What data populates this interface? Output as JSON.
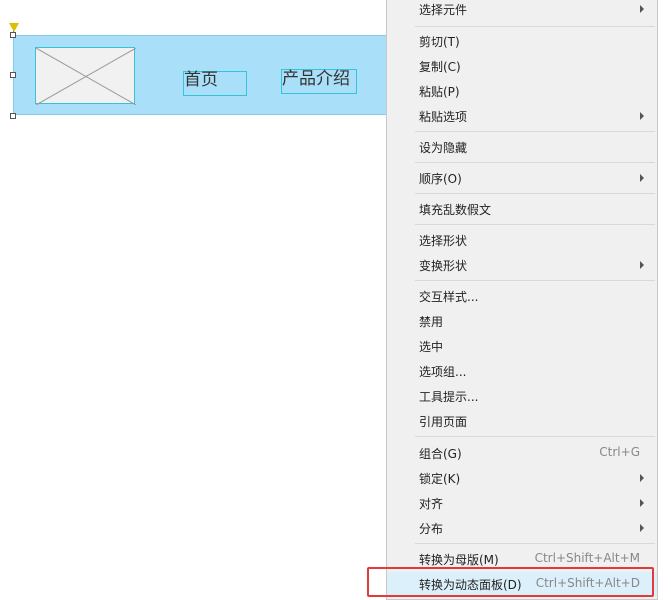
{
  "canvas": {
    "nav_home": "首页",
    "nav_products": "产品介绍"
  },
  "context_menu": {
    "items": [
      {
        "label": "选择元件",
        "submenu": true
      },
      {
        "label": "剪切(T)"
      },
      {
        "label": "复制(C)"
      },
      {
        "label": "粘贴(P)"
      },
      {
        "label": "粘贴选项",
        "submenu": true
      },
      {
        "label": "设为隐藏"
      },
      {
        "label": "顺序(O)",
        "submenu": true
      },
      {
        "label": "填充乱数假文"
      },
      {
        "label": "选择形状"
      },
      {
        "label": "变换形状",
        "submenu": true
      },
      {
        "label": "交互样式..."
      },
      {
        "label": "禁用"
      },
      {
        "label": "选中"
      },
      {
        "label": "选项组..."
      },
      {
        "label": "工具提示..."
      },
      {
        "label": "引用页面"
      },
      {
        "label": "组合(G)",
        "shortcut": "Ctrl+G"
      },
      {
        "label": "锁定(K)",
        "submenu": true
      },
      {
        "label": "对齐",
        "submenu": true
      },
      {
        "label": "分布",
        "submenu": true
      },
      {
        "label": "转换为母版(M)",
        "shortcut": "Ctrl+Shift+Alt+M"
      },
      {
        "label": "转换为动态面板(D)",
        "shortcut": "Ctrl+Shift+Alt+D",
        "highlighted": true
      }
    ]
  },
  "colors": {
    "banner": "#a9dff8",
    "selection_outline": "#36c3d3",
    "highlight": "#dcf0fb",
    "annotation_red": "#e03a3a"
  }
}
